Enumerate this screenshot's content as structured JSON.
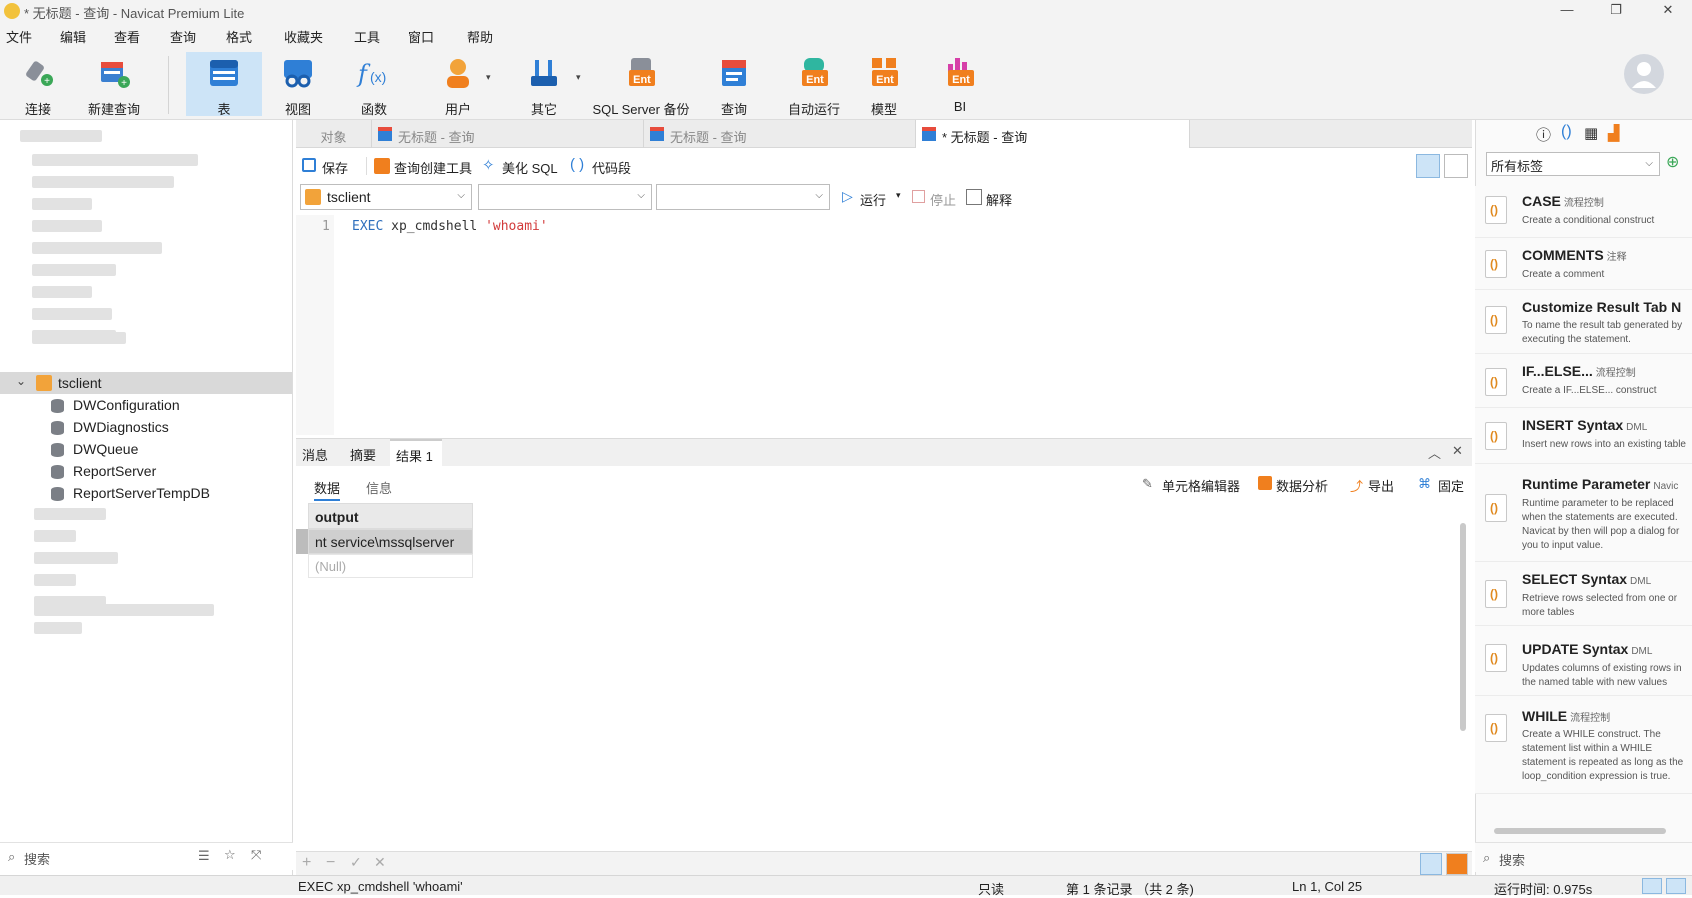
{
  "window": {
    "title": "* 无标题 - 查询 - Navicat Premium Lite",
    "minimize": "—",
    "maximize": "❐",
    "close": "✕"
  },
  "menu": [
    "文件",
    "编辑",
    "查看",
    "查询",
    "格式",
    "收藏夹",
    "工具",
    "窗口",
    "帮助"
  ],
  "toolbar": [
    {
      "label": "连接",
      "icon": "connect-icon"
    },
    {
      "label": "新建查询",
      "icon": "new-query-icon"
    },
    {
      "label": "表",
      "icon": "table-icon",
      "active": true
    },
    {
      "label": "视图",
      "icon": "view-icon"
    },
    {
      "label": "函数",
      "icon": "function-icon"
    },
    {
      "label": "用户",
      "icon": "user-icon"
    },
    {
      "label": "其它",
      "icon": "other-icon"
    },
    {
      "label": "SQL Server 备份",
      "icon": "backup-icon"
    },
    {
      "label": "查询",
      "icon": "query-icon"
    },
    {
      "label": "自动运行",
      "icon": "auto-run-icon"
    },
    {
      "label": "模型",
      "icon": "model-icon"
    },
    {
      "label": "BI",
      "icon": "bi-icon"
    }
  ],
  "tree": {
    "connection": "tsclient",
    "databases": [
      "DWConfiguration",
      "DWDiagnostics",
      "DWQueue",
      "ReportServer",
      "ReportServerTempDB"
    ]
  },
  "left_search": {
    "placeholder": "搜索"
  },
  "tabs": {
    "objects": "对象",
    "tab1": "无标题 - 查询",
    "tab2": "无标题 - 查询",
    "tab3": "* 无标题 - 查询"
  },
  "query_toolbar": {
    "save": "保存",
    "builder": "查询创建工具",
    "beautify": "美化 SQL",
    "snippet": "代码段"
  },
  "query_toolbar2": {
    "connection": "tsclient",
    "database": "",
    "schema": "",
    "run": "运行",
    "stop": "停止",
    "explain": "解释"
  },
  "editor": {
    "line_no": "1",
    "keyword": "EXEC",
    "code": " xp_cmdshell ",
    "string": "'whoami'"
  },
  "result_tabs": {
    "messages": "消息",
    "summary": "摘要",
    "result": "结果 1"
  },
  "result_sub": {
    "data": "数据",
    "info": "信息",
    "cell_editor": "单元格编辑器",
    "analysis": "数据分析",
    "export": "导出",
    "pin": "固定"
  },
  "grid": {
    "header": "output",
    "rows": [
      "nt service\\mssqlserver",
      "(Null)"
    ]
  },
  "status": {
    "sql": "EXEC xp_cmdshell 'whoami'",
    "mode": "只读",
    "records": "第 1 条记录 （共 2 条)",
    "pos": "Ln 1, Col 25",
    "time": "运行时间: 0.975s"
  },
  "right": {
    "tag_filter": "所有标签",
    "search": "搜索"
  },
  "snippets": [
    {
      "name": "CASE",
      "tag": "流程控制",
      "desc": "Create a conditional construct"
    },
    {
      "name": "COMMENTS",
      "tag": "注释",
      "desc": "Create a comment"
    },
    {
      "name": "Customize Result Tab N",
      "tag": "",
      "desc": "To name the result tab generated by executing the statement."
    },
    {
      "name": "IF...ELSE...",
      "tag": "流程控制",
      "desc": "Create a IF...ELSE... construct"
    },
    {
      "name": "INSERT Syntax",
      "tag": "DML",
      "desc": "Insert new rows into an existing table"
    },
    {
      "name": "Runtime Parameter",
      "tag": "Navic",
      "desc": "Runtime parameter to be replaced when the statements are executed. Navicat by then will pop a dialog for you to input value."
    },
    {
      "name": "SELECT Syntax",
      "tag": "DML",
      "desc": "Retrieve rows selected from one or more tables"
    },
    {
      "name": "UPDATE Syntax",
      "tag": "DML",
      "desc": "Updates columns of existing rows in the named table with new values"
    },
    {
      "name": "WHILE",
      "tag": "流程控制",
      "desc": "Create a WHILE construct. The statement list within a WHILE statement is repeated as long as the loop_condition expression is true."
    }
  ],
  "colors": {
    "accent": "#1a73c9",
    "active_tool": "#cde4f7",
    "keyword": "#2f6fbd",
    "string": "#d23a3a"
  }
}
